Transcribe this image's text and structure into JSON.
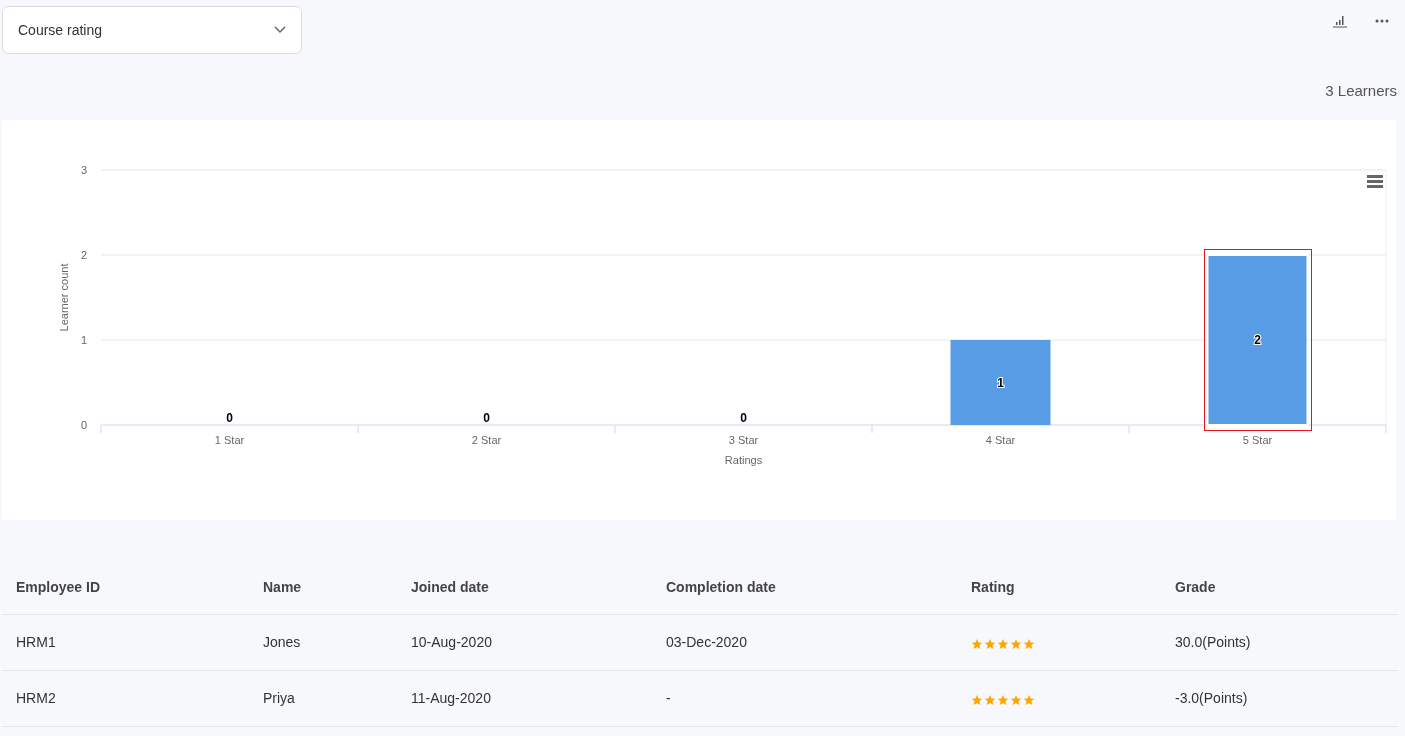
{
  "report_select": {
    "value": "Course rating"
  },
  "learner_count": "3 Learners",
  "chart": {
    "bars": [
      {
        "hovered": false
      },
      {
        "hovered": false
      },
      {
        "hovered": false
      },
      {
        "hovered": false
      },
      {
        "hovered": true
      }
    ],
    "chart_data": {
      "type": "bar",
      "xlabel": "Ratings",
      "ylabel": "Learner count",
      "categories": [
        "1 Star",
        "2 Star",
        "3 Star",
        "4 Star",
        "5 Star"
      ],
      "series": [
        {
          "color": "#579ce4",
          "values": [
            0,
            0,
            0,
            1,
            2
          ]
        }
      ],
      "ylim": [
        0,
        3
      ],
      "yticks": [
        0,
        1,
        2,
        3
      ],
      "data_labels": true
    }
  },
  "table": {
    "columns": [
      "Employee ID",
      "Name",
      "Joined date",
      "Completion date",
      "Rating",
      "Grade"
    ],
    "rows": [
      {
        "employee_id": "HRM1",
        "name": "Jones",
        "joined": "10-Aug-2020",
        "completed": "03-Dec-2020",
        "stars": 5,
        "grade": "30.0(Points)"
      },
      {
        "employee_id": "HRM2",
        "name": "Priya",
        "joined": "11-Aug-2020",
        "completed": "-",
        "stars": 5,
        "grade": "-3.0(Points)"
      }
    ]
  }
}
